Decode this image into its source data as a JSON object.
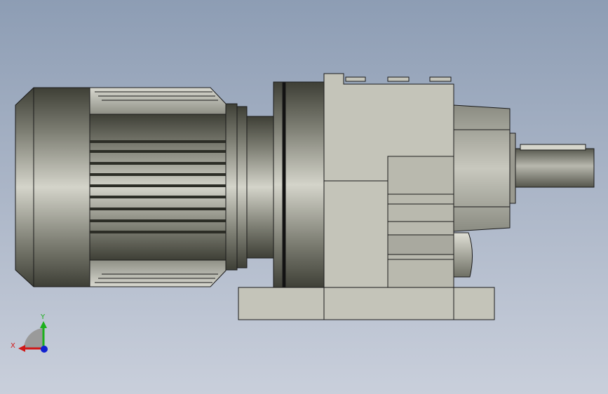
{
  "view": {
    "type": "cad-orthographic-side-view",
    "subject": "helical-gearmotor",
    "background_top": "#8d9db4",
    "background_bottom": "#c9cfdb",
    "edge_color": "#1a1a1a"
  },
  "triad": {
    "x_label": "X",
    "y_label": "Y",
    "x_color": "#d01818",
    "y_color": "#1cb01c",
    "z_color": "#1020d0"
  },
  "colors": {
    "motor_dark": "#4a4b40",
    "motor_light": "#d6d6cc",
    "housing": "#c4c4b9",
    "housing_shadow": "#a9a99f",
    "shaft": "#9a9a90"
  }
}
